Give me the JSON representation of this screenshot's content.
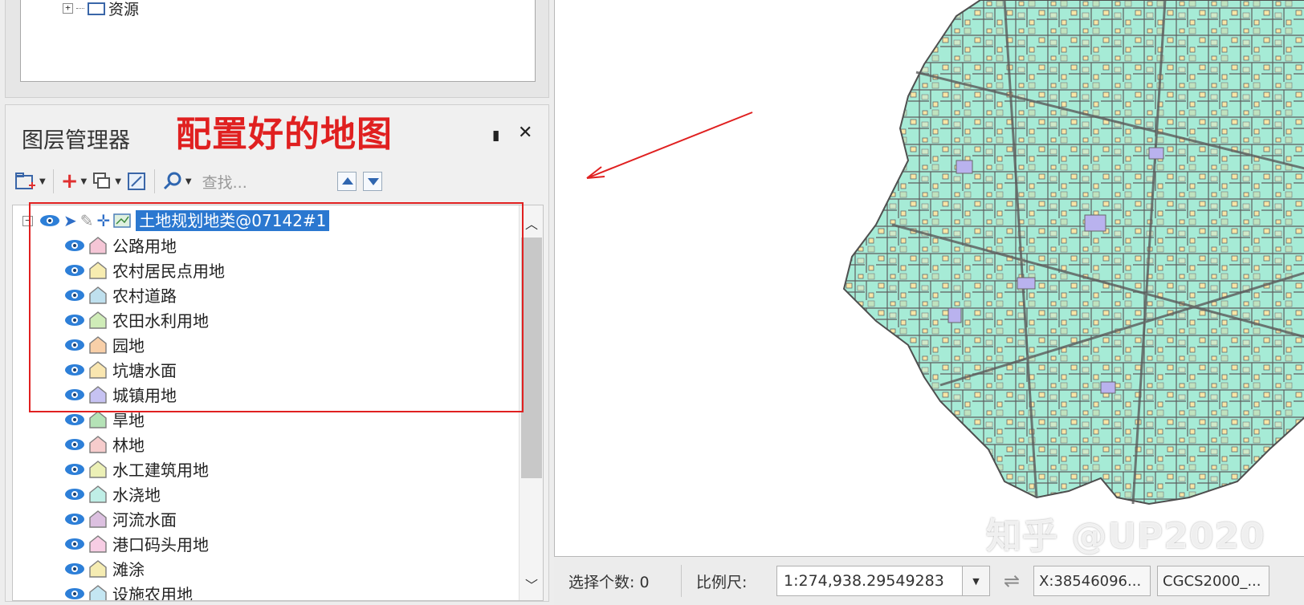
{
  "resources_panel": {
    "node_label": "资源"
  },
  "layer_manager": {
    "title": "图层管理器",
    "annotation": "配置好的地图",
    "search_placeholder": "查找...",
    "root_layer": "土地规划地类@07142#1",
    "sublayers": [
      {
        "label": "公路用地",
        "color": "#f5c6d6"
      },
      {
        "label": "农村居民点用地",
        "color": "#f7ecb0"
      },
      {
        "label": "农村道路",
        "color": "#bfe0ee"
      },
      {
        "label": "农田水利用地",
        "color": "#cfecb8"
      },
      {
        "label": "园地",
        "color": "#f8cfa8"
      },
      {
        "label": "坑塘水面",
        "color": "#f9e6b0"
      },
      {
        "label": "城镇用地",
        "color": "#c6c2f2"
      },
      {
        "label": "旱地",
        "color": "#b4e2b6"
      },
      {
        "label": "林地",
        "color": "#f6cccc"
      },
      {
        "label": "水工建筑用地",
        "color": "#ecf0b6"
      },
      {
        "label": "水浇地",
        "color": "#bfeee6"
      },
      {
        "label": "河流水面",
        "color": "#dcc0e0"
      },
      {
        "label": "港口码头用地",
        "color": "#f7cde4"
      },
      {
        "label": "滩涂",
        "color": "#f5ecb2"
      },
      {
        "label": "设施农用地",
        "color": "#c4e6f2"
      }
    ]
  },
  "status_bar": {
    "selected_count": "选择个数: 0",
    "scale_label": "比例尺:",
    "scale_value": "1:274,938.29549283",
    "coord": "X:38546096...",
    "crs": "CGCS2000_..."
  },
  "watermark": "知乎 @UP2020",
  "colors": {
    "accent_red": "#e02020",
    "selection_blue": "#2b78d0",
    "map_fill": "#9fe8d2",
    "map_line": "#5a5a5a"
  }
}
